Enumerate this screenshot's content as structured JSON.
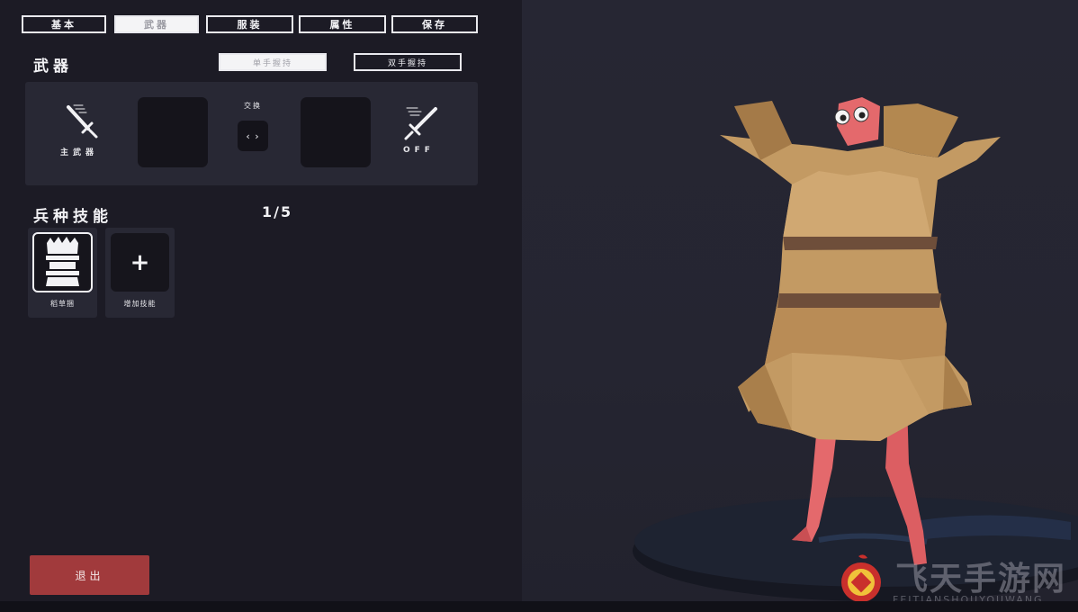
{
  "tabs": [
    {
      "label": "基本",
      "active": false
    },
    {
      "label": "武器",
      "active": true
    },
    {
      "label": "服装",
      "active": false
    },
    {
      "label": "属性",
      "active": false
    },
    {
      "label": "保存",
      "active": false
    }
  ],
  "weapons": {
    "title": "武器",
    "grip_one_hand": "单手握持",
    "grip_two_hand": "双手握持",
    "main_label": "主武器",
    "swap_label": "交换",
    "swap_symbol": "‹ ›",
    "off_label": "OFF"
  },
  "skills": {
    "title": "兵种技能",
    "count": "1/5",
    "items": [
      {
        "label": "稻草捆",
        "icon": "straw-armor-icon"
      },
      {
        "label": "增加技能",
        "icon": "plus-icon",
        "symbol": "+"
      }
    ]
  },
  "exit_label": "退出",
  "watermark": {
    "cn": "飞天手游网",
    "en": "FEITIANSHOUYOUWANG"
  },
  "colors": {
    "exit": "#a13a3c",
    "panel": "#1c1b25",
    "card": "#282834",
    "straw": "#c39a63",
    "skin": "#e4696c"
  }
}
